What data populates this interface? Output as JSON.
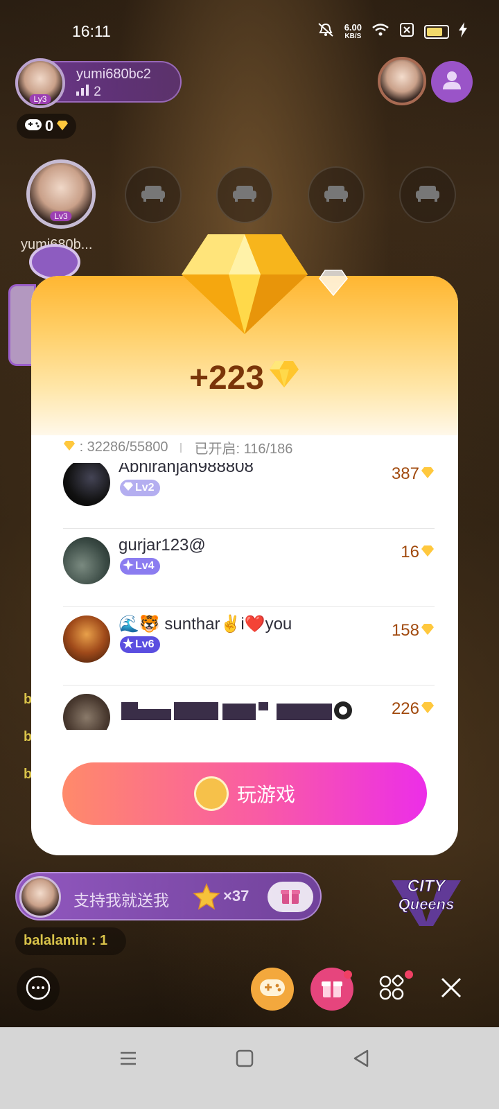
{
  "status_bar": {
    "time": "16:11",
    "net_speed_value": "6.00",
    "net_speed_unit": "KB/S"
  },
  "host": {
    "name": "yumi680bc2",
    "listeners": "2",
    "level": "Ly3"
  },
  "game_chip": {
    "count": "0"
  },
  "seat_main": {
    "name": "yumi680b...",
    "level": "Lv3"
  },
  "modal": {
    "reward_amount": "+223",
    "progress_left": ": 32286/55800",
    "progress_right": "已开启: 116/186",
    "rows": [
      {
        "name": "Abhiranjan988808",
        "level": "Lv2",
        "amount": "387"
      },
      {
        "name": "gurjar123@",
        "level": "Lv4",
        "amount": "16"
      },
      {
        "name": "🌊🐯 sunthar✌️i❤️you",
        "level": "Lv6",
        "amount": "158"
      },
      {
        "name": "",
        "level": "",
        "amount": "226"
      }
    ],
    "play_button_label": "玩游戏"
  },
  "chat": {
    "lines": [
      "b",
      "b",
      "b"
    ]
  },
  "support": {
    "text": "支持我就送我",
    "count": "×37"
  },
  "balalamin_chip": {
    "text": "balalamin : 1"
  },
  "colors": {
    "accent_purple": "#9a54c8",
    "gold": "#ffc83d",
    "reward_brown": "#7a3509",
    "play_gradient_start": "#ff8a6a",
    "play_gradient_end": "#ec2ee8"
  }
}
